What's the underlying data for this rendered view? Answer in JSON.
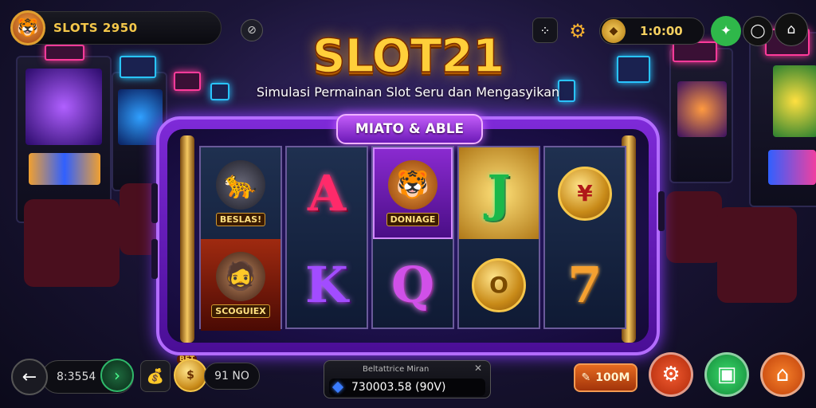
{
  "header": {
    "balance": "SLOTS 2950",
    "timer": "1:0:00",
    "icons": {
      "avatar": "tiger-avatar-icon",
      "left_circle": "compass-icon",
      "grid": "grid-icon",
      "settings": "gear-icon",
      "coin": "coin-icon",
      "notification": "bell-icon",
      "camera": "camera-icon",
      "home": "home-icon"
    }
  },
  "logo": {
    "title": "SLOT21",
    "subtitle": "Simulasi Permainan Slot Seru dan Mengasyikan"
  },
  "reels": {
    "title": "MIATO & ABLE",
    "columns": [
      {
        "top": {
          "type": "character",
          "icon": "panther-icon",
          "label": "BESLAS!"
        },
        "bottom": {
          "type": "character",
          "icon": "man-hat-icon",
          "label": "SCOGUIEX"
        }
      },
      {
        "top": {
          "type": "letter",
          "text": "A"
        },
        "bottom": {
          "type": "letter",
          "text": "K"
        }
      },
      {
        "top": {
          "type": "character",
          "icon": "tiger-icon",
          "label": "DONIAGE"
        },
        "bottom": {
          "type": "letter",
          "text": "Q"
        }
      },
      {
        "top": {
          "type": "letter",
          "text": "J"
        },
        "bottom": {
          "type": "coin",
          "text": "O"
        }
      },
      {
        "top": {
          "type": "coin",
          "text": "¥"
        },
        "bottom": {
          "type": "letter",
          "text": "7"
        }
      }
    ]
  },
  "footer": {
    "bet_value": "8:3554",
    "badge": "BET",
    "win_value": "91 NO",
    "info_title": "Beltattrice Miran",
    "info_value": "730003.58 (90V)",
    "spin_bet": "100M",
    "icons": {
      "back": "arrow-left-icon",
      "go": "chevron-right-icon",
      "bag": "coin-bag-icon",
      "coin": "gold-coin-icon",
      "close": "close-icon",
      "gem": "gem-icon",
      "settings": "gear-icon",
      "ticket": "ticket-icon",
      "home": "home-icon"
    }
  },
  "colors": {
    "gold": "#ffcf3a",
    "purple_frame": "#7e2ad8",
    "orange": "#e56a20",
    "green": "#2fb86a"
  }
}
